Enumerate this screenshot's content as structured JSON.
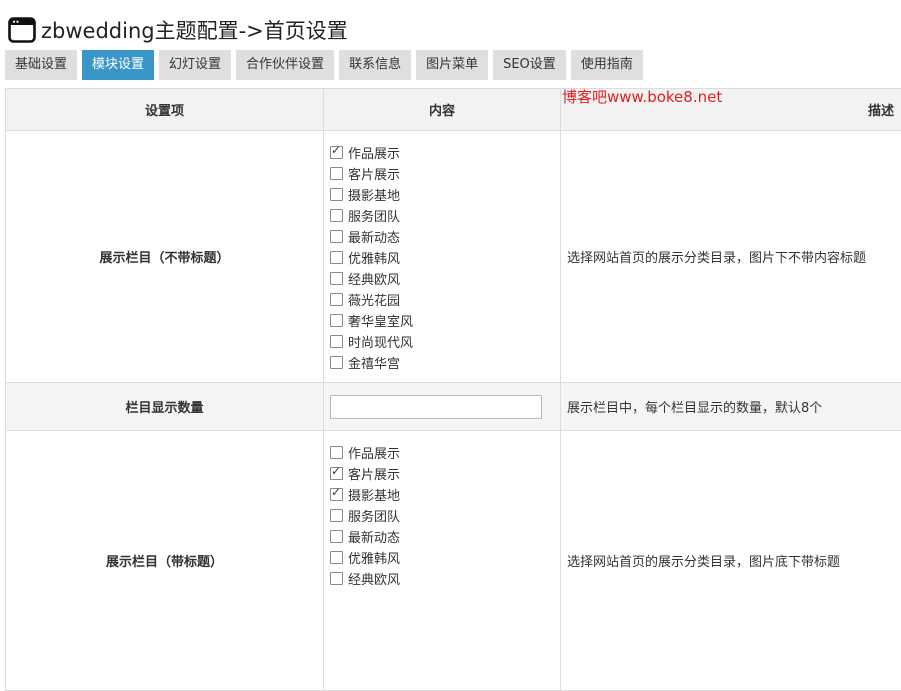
{
  "header": {
    "title": "zbwedding主题配置->首页设置",
    "icon": "window-icon"
  },
  "tabs": [
    {
      "label": "基础设置",
      "active": false
    },
    {
      "label": "模块设置",
      "active": true
    },
    {
      "label": "幻灯设置",
      "active": false
    },
    {
      "label": "合作伙伴设置",
      "active": false
    },
    {
      "label": "联系信息",
      "active": false
    },
    {
      "label": "图片菜单",
      "active": false
    },
    {
      "label": "SEO设置",
      "active": false
    },
    {
      "label": "使用指南",
      "active": false
    }
  ],
  "watermark": "博客吧www.boke8.net",
  "table": {
    "headers": {
      "item": "设置项",
      "content": "内容",
      "desc": "描述"
    },
    "rows": [
      {
        "label": "展示栏目（不带标题）",
        "options": [
          {
            "label": "作品展示",
            "checked": true
          },
          {
            "label": "客片展示",
            "checked": false
          },
          {
            "label": "摄影基地",
            "checked": false
          },
          {
            "label": "服务团队",
            "checked": false
          },
          {
            "label": "最新动态",
            "checked": false
          },
          {
            "label": "优雅韩风",
            "checked": false
          },
          {
            "label": "经典欧风",
            "checked": false
          },
          {
            "label": "薇光花园",
            "checked": false
          },
          {
            "label": "奢华皇室风",
            "checked": false
          },
          {
            "label": "时尚现代风",
            "checked": false
          },
          {
            "label": "金禧华宫",
            "checked": false
          }
        ],
        "desc": "选择网站首页的展示分类目录，图片下不带内容标题"
      },
      {
        "label": "栏目显示数量",
        "input_value": "",
        "input_placeholder": "",
        "desc": "展示栏目中，每个栏目显示的数量，默认8个"
      },
      {
        "label": "展示栏目（带标题）",
        "options": [
          {
            "label": "作品展示",
            "checked": false
          },
          {
            "label": "客片展示",
            "checked": true
          },
          {
            "label": "摄影基地",
            "checked": true
          },
          {
            "label": "服务团队",
            "checked": false
          },
          {
            "label": "最新动态",
            "checked": false
          },
          {
            "label": "优雅韩风",
            "checked": false
          },
          {
            "label": "经典欧风",
            "checked": false
          }
        ],
        "desc": "选择网站首页的展示分类目录，图片底下带标题"
      }
    ]
  },
  "colors": {
    "active_tab": "#3a96c8",
    "tab": "#dfdfdf",
    "watermark": "#e02020",
    "header_bg": "#f2f2f2"
  }
}
